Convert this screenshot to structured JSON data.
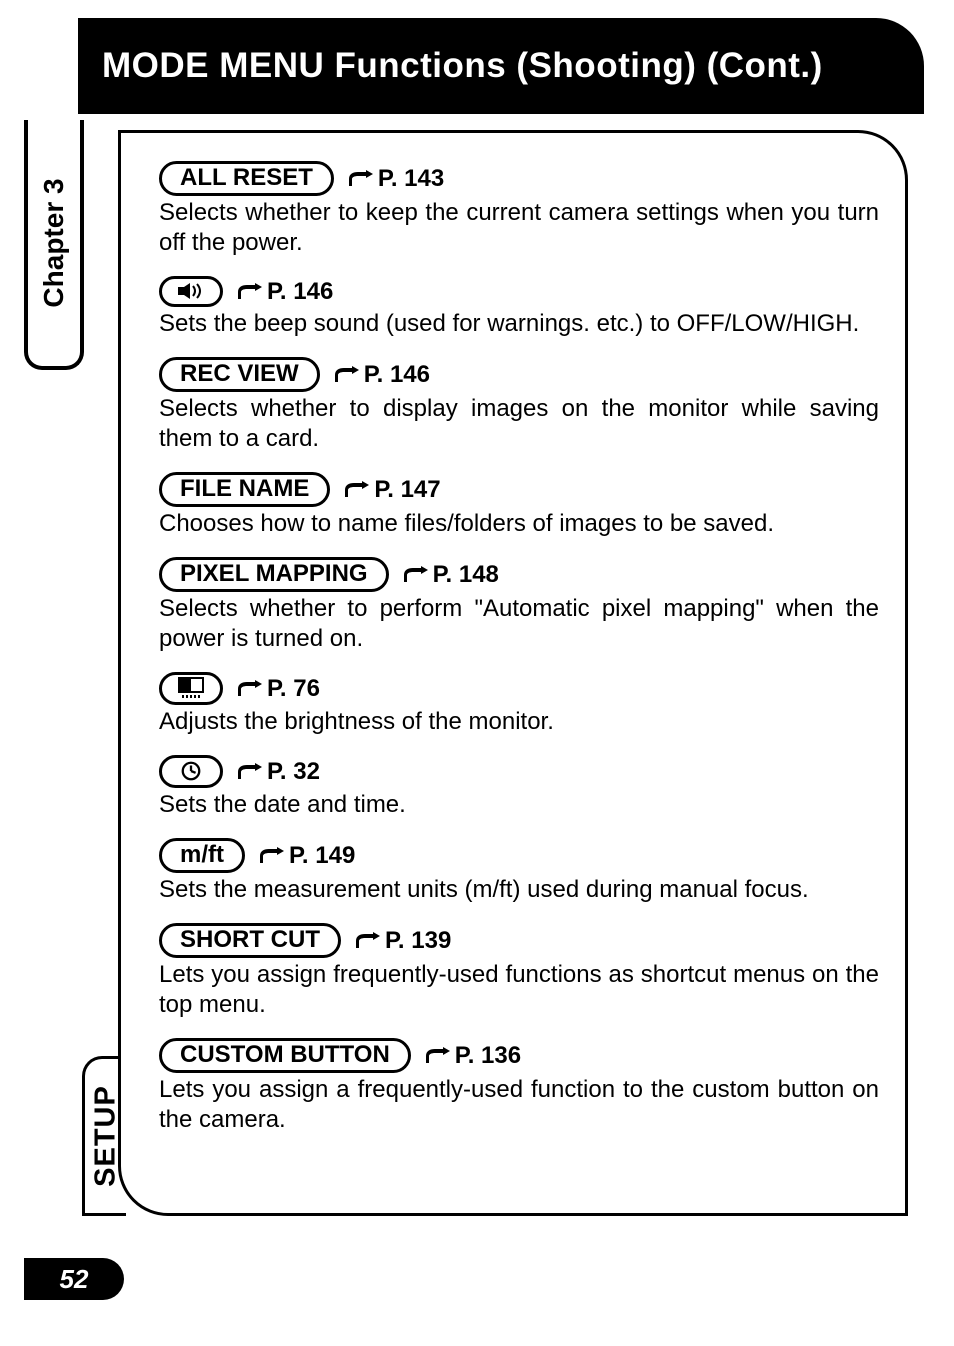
{
  "header": {
    "title": "MODE MENU Functions (Shooting) (Cont.)"
  },
  "side_tab": {
    "label": "Chapter 3"
  },
  "content_tab": {
    "label": "SETUP"
  },
  "page_number": "52",
  "items": [
    {
      "label": "ALL RESET",
      "page_ref": "P. 143",
      "desc": "Selects whether to keep the current camera settings when you turn off the power.",
      "icon": null
    },
    {
      "label": null,
      "page_ref": "P. 146",
      "desc": "Sets the beep sound (used for warnings. etc.) to OFF/LOW/HIGH.",
      "icon": "beep"
    },
    {
      "label": "REC VIEW",
      "page_ref": "P. 146",
      "desc": "Selects whether to display images on the monitor while saving them to a card.",
      "icon": null
    },
    {
      "label": "FILE NAME",
      "page_ref": "P. 147",
      "desc": "Chooses how to name files/folders of images to be saved.",
      "icon": null
    },
    {
      "label": "PIXEL MAPPING",
      "page_ref": "P. 148",
      "desc": "Selects whether to perform \"Automatic pixel mapping\" when the power is turned on.",
      "icon": null
    },
    {
      "label": null,
      "page_ref": "P. 76",
      "desc": "Adjusts the brightness of the monitor.",
      "icon": "monitor"
    },
    {
      "label": null,
      "page_ref": "P. 32",
      "desc": "Sets the date and time.",
      "icon": "clock"
    },
    {
      "label": "m/ft",
      "page_ref": "P. 149",
      "desc": "Sets the measurement units (m/ft) used during manual focus.",
      "icon": null
    },
    {
      "label": "SHORT CUT",
      "page_ref": "P. 139",
      "desc": "Lets you assign frequently-used functions as shortcut menus on the top menu.",
      "icon": null
    },
    {
      "label": "CUSTOM BUTTON",
      "page_ref": "P. 136",
      "desc": "Lets you assign a frequently-used function to the custom button on the camera.",
      "icon": null
    }
  ]
}
